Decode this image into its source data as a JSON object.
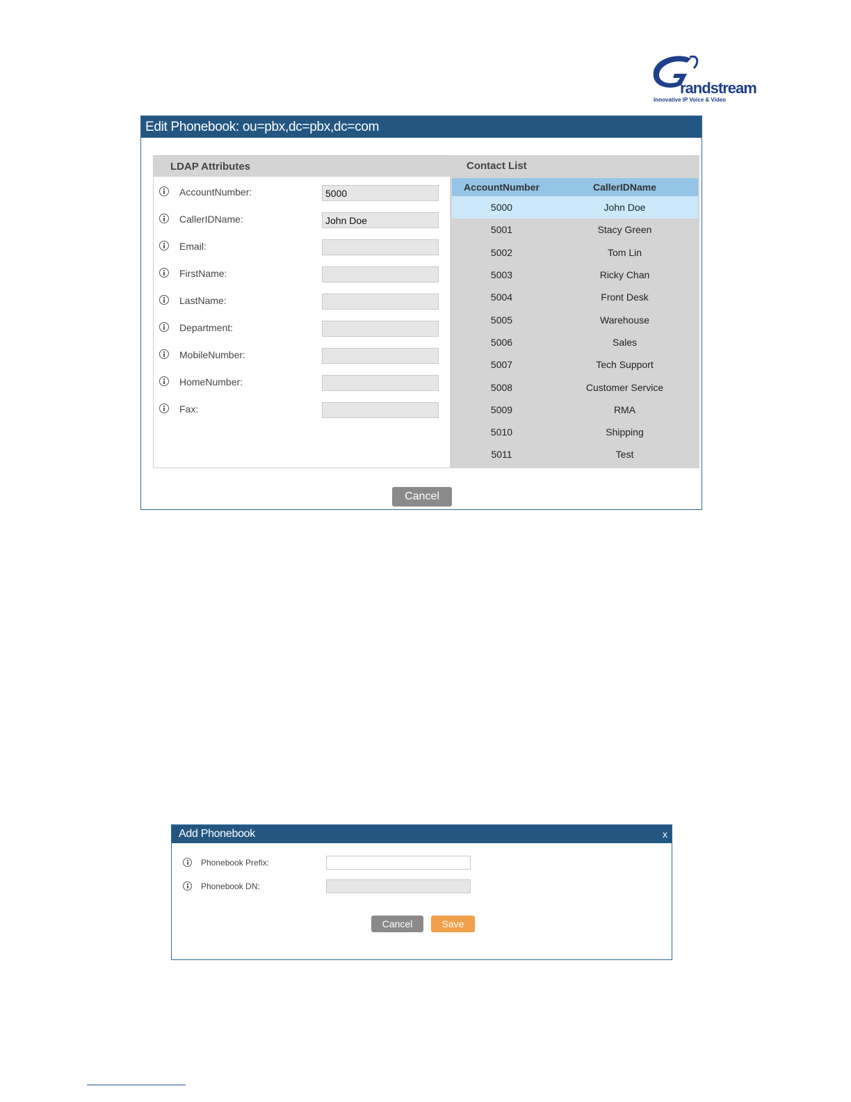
{
  "logo": {
    "name": "Grandstream",
    "word": "randstream",
    "tagline": "Innovative IP Voice & Video"
  },
  "edit_dialog": {
    "title": "Edit Phonebook: ou=pbx,dc=pbx,dc=com",
    "ldap_panel": {
      "title": "LDAP Attributes",
      "fields": [
        {
          "label": "AccountNumber:",
          "value": "5000"
        },
        {
          "label": "CallerIDName:",
          "value": "John Doe"
        },
        {
          "label": "Email:",
          "value": ""
        },
        {
          "label": "FirstName:",
          "value": ""
        },
        {
          "label": "LastName:",
          "value": ""
        },
        {
          "label": "Department:",
          "value": ""
        },
        {
          "label": "MobileNumber:",
          "value": ""
        },
        {
          "label": "HomeNumber:",
          "value": ""
        },
        {
          "label": "Fax:",
          "value": ""
        }
      ]
    },
    "contact_panel": {
      "title": "Contact List",
      "columns": [
        "AccountNumber",
        "CallerIDName"
      ],
      "rows": [
        {
          "account": "5000",
          "name": "John Doe",
          "selected": true
        },
        {
          "account": "5001",
          "name": "Stacy Green"
        },
        {
          "account": "5002",
          "name": "Tom Lin"
        },
        {
          "account": "5003",
          "name": "Ricky Chan"
        },
        {
          "account": "5004",
          "name": "Front Desk"
        },
        {
          "account": "5005",
          "name": "Warehouse"
        },
        {
          "account": "5006",
          "name": "Sales"
        },
        {
          "account": "5007",
          "name": "Tech Support"
        },
        {
          "account": "5008",
          "name": "Customer Service"
        },
        {
          "account": "5009",
          "name": "RMA"
        },
        {
          "account": "5010",
          "name": "Shipping"
        },
        {
          "account": "5011",
          "name": "Test"
        }
      ]
    },
    "cancel_label": "Cancel"
  },
  "add_dialog": {
    "title": "Add Phonebook",
    "close_label": "x",
    "fields": [
      {
        "label": "Phonebook Prefix:",
        "value": ""
      },
      {
        "label": "Phonebook DN:",
        "value": ""
      }
    ],
    "cancel_label": "Cancel",
    "save_label": "Save"
  },
  "colors": {
    "header_blue": "#235782",
    "table_header": "#94c5e6",
    "selected_row": "#cbe9fb",
    "save_orange": "#f0a04b",
    "cancel_grey": "#8a8a8a"
  }
}
